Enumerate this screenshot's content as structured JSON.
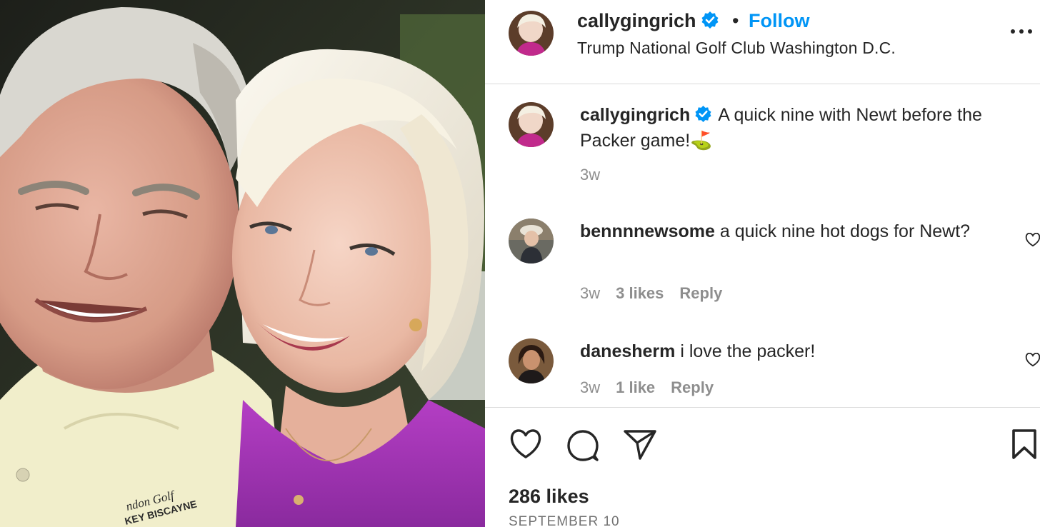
{
  "header": {
    "username": "callygingrich",
    "separator": "•",
    "follow_label": "Follow",
    "location": "Trump National Golf Club Washington D.C."
  },
  "caption": {
    "username": "callygingrich",
    "text": "A quick nine with Newt before the Packer game!⛳",
    "time": "3w"
  },
  "comments": [
    {
      "username": "bennnnewsome",
      "text": "a quick nine hot dogs for Newt?",
      "time": "3w",
      "likes": "3 likes",
      "reply_label": "Reply"
    },
    {
      "username": "danesherm",
      "text": "i love the packer!",
      "time": "3w",
      "likes": "1 like",
      "reply_label": "Reply"
    }
  ],
  "footer": {
    "likes": "286 likes",
    "date": "SEPTEMBER 10"
  },
  "photo": {
    "shirt_text_line1": "ndon Golf",
    "shirt_text_line2": "KEY BISCAYNE"
  },
  "icons": {
    "verified": "verified-badge-icon",
    "more": "more-options-icon",
    "like": "heart-icon",
    "comment": "comment-bubble-icon",
    "share": "paper-plane-icon",
    "save": "bookmark-icon"
  },
  "colors": {
    "accent": "#0095f6",
    "text": "#262626",
    "muted": "#8e8e8e",
    "divider": "#dbdbdb"
  }
}
